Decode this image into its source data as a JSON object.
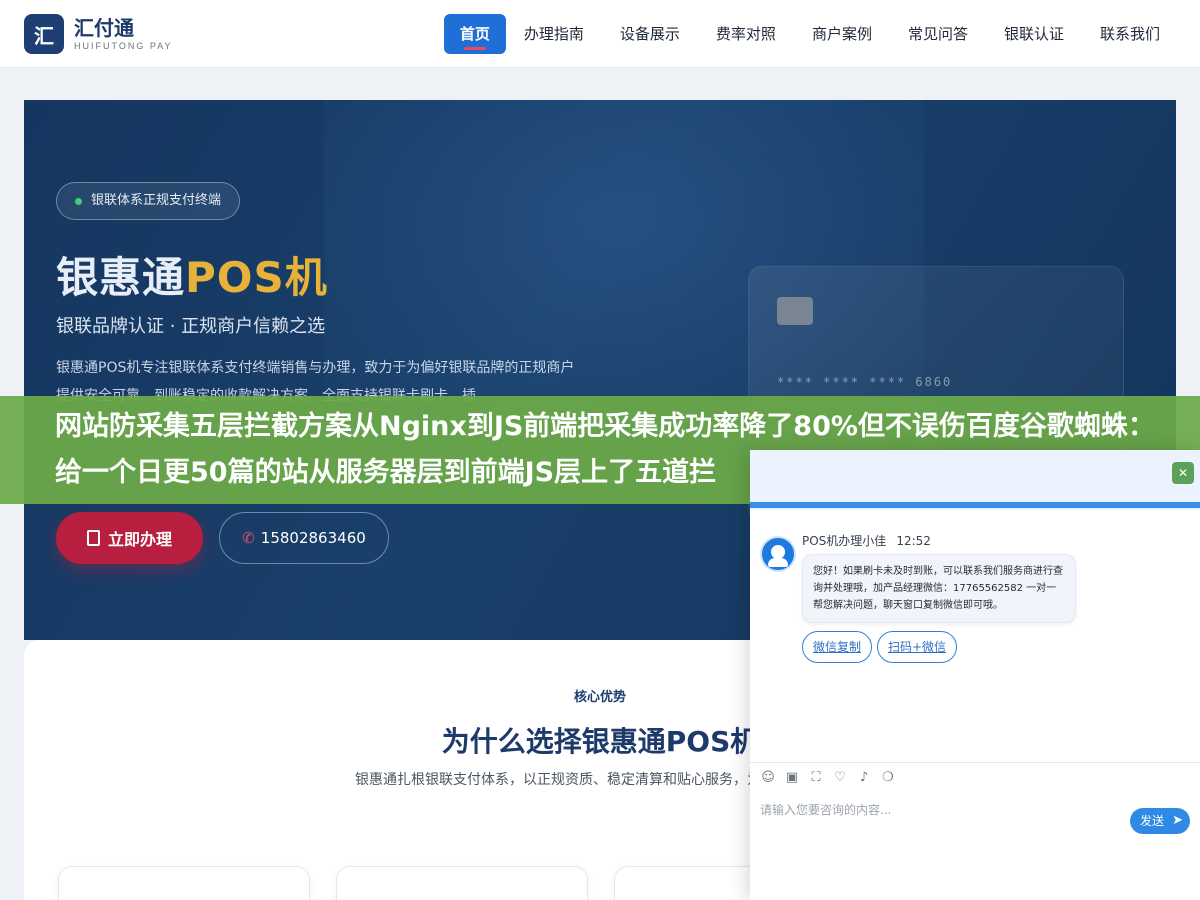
{
  "header": {
    "logo_mark": "汇",
    "logo_title": "汇付通",
    "logo_sub": "HUIFUTONG PAY",
    "nav": [
      {
        "label": "首页"
      },
      {
        "label": "办理指南"
      },
      {
        "label": "设备展示"
      },
      {
        "label": "费率对照"
      },
      {
        "label": "商户案例"
      },
      {
        "label": "常见问答"
      },
      {
        "label": "银联认证"
      },
      {
        "label": "联系我们"
      }
    ]
  },
  "hero": {
    "pill": "银联体系正规支付终端",
    "title_main": "银惠通",
    "title_accent": "POS机",
    "subtitle": "银联品牌认证 · 正规商户信赖之选",
    "description": "银惠通POS机专注银联体系支付终端销售与办理，致力于为偏好银联品牌的正规商户提供安全可靠、到账稳定的收款解决方案。全面支持银联卡刷卡、插",
    "apply_label": "立即办理",
    "phone": "15802863460",
    "card_number": "**** **** **** 6860"
  },
  "banner": {
    "text": "网站防采集五层拦截方案从Nginx到JS前端把采集成功率降了80%但不误伤百度谷歌蜘蛛：给一个日更50篇的站从服务器层到前端JS层上了五道拦"
  },
  "why": {
    "eyebrow": "核心优势",
    "title": "为什么选择银惠通POS机",
    "description": "银惠通扎根银联支付体系，以正规资质、稳定清算和贴心服务，为每一款终端。"
  },
  "chat": {
    "close_glyph": "✕",
    "agent_name": "POS机办理小佳",
    "time": "12:52",
    "message": "您好！如果刷卡未及时到账，可以联系我们服务商进行查询并处理哦，加产品经理微信：17765562582 一对一帮您解决问题，聊天窗口复制微信即可哦。",
    "actions": [
      {
        "label": "微信复制"
      },
      {
        "label": "扫码+微信"
      }
    ],
    "tools": [
      {
        "icon": "emoji-icon",
        "glyph": "☺"
      },
      {
        "icon": "image-icon",
        "glyph": "▣"
      },
      {
        "icon": "screenshot-icon",
        "glyph": "⛶"
      },
      {
        "icon": "rating-icon",
        "glyph": "♡"
      },
      {
        "icon": "sound-icon",
        "glyph": "♪"
      },
      {
        "icon": "chat-bubbles-icon",
        "glyph": "❍"
      }
    ],
    "input_placeholder": "请输入您要咨询的内容...",
    "send_label": "发送"
  },
  "colors": {
    "brand": "#1e3f73",
    "nav_active": "#1f6fd6",
    "apply_button": "#b81f3f",
    "accent_gold": "#e7b23a",
    "banner": "#6caa48",
    "chat_accent": "#3b8ee8"
  }
}
